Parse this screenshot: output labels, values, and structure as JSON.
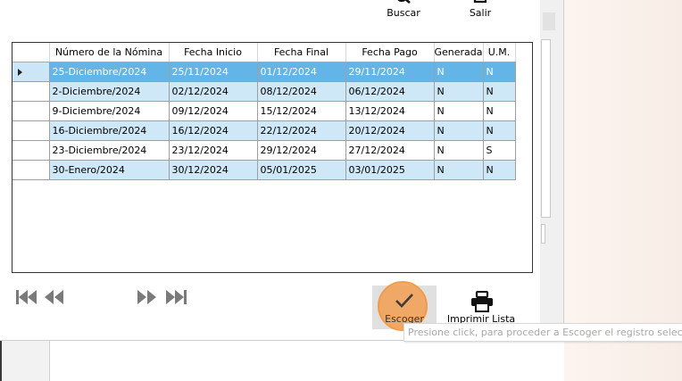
{
  "toolbar": {
    "search_label": "Buscar",
    "exit_label": "Salir"
  },
  "grid": {
    "columns": [
      "Número de la Nómina",
      "Fecha Inicio",
      "Fecha Final",
      "Fecha Pago",
      "Generada",
      "U.M."
    ],
    "rows": [
      [
        "25-Diciembre/2024",
        "25/11/2024",
        "01/12/2024",
        "29/11/2024",
        "N",
        "N"
      ],
      [
        "2-Diciembre/2024",
        "02/12/2024",
        "08/12/2024",
        "06/12/2024",
        "N",
        "N"
      ],
      [
        "9-Diciembre/2024",
        "09/12/2024",
        "15/12/2024",
        "13/12/2024",
        "N",
        "N"
      ],
      [
        "16-Diciembre/2024",
        "16/12/2024",
        "22/12/2024",
        "20/12/2024",
        "N",
        "N"
      ],
      [
        "23-Diciembre/2024",
        "23/12/2024",
        "29/12/2024",
        "27/12/2024",
        "N",
        "S"
      ],
      [
        "30-Enero/2024",
        "30/12/2024",
        "05/01/2025",
        "03/01/2025",
        "N",
        "N"
      ]
    ],
    "selected_row": 0
  },
  "navigation": {
    "icons": [
      "first-page-icon",
      "previous-page-icon",
      "next-page-icon",
      "last-page-icon"
    ]
  },
  "actions": {
    "choose_label": "Escoger",
    "print_label": "Imprimir Lista"
  },
  "tooltip": {
    "text": "Presione click, para proceder a Escoger el registro selecciona"
  },
  "colors": {
    "selected_row": "#62b5e6",
    "alt_row": "#cfe8f7",
    "highlight_ring": "#f2a45c"
  }
}
